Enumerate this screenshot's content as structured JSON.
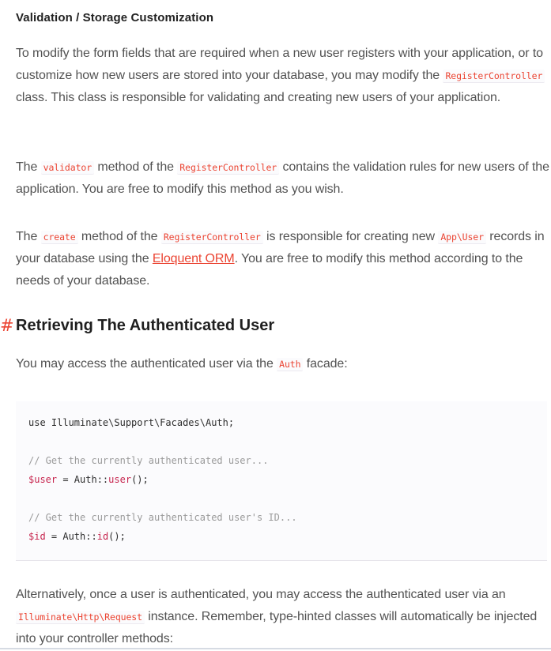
{
  "section_title": "Validation / Storage Customization",
  "paragraph1": {
    "before": "To modify the form fields that are required when a new user registers with your application, or to customize how new users are stored into your database, you may modify the ",
    "code": "RegisterController",
    "after": " class. This class is responsible for validating and creating new users of your application."
  },
  "paragraph2": {
    "t1": "The ",
    "code1": "validator",
    "t2": " method of the ",
    "code2": "RegisterController",
    "t3": " contains the validation rules for new users of the application. You are free to modify this method as you wish."
  },
  "paragraph3": {
    "t1": "The ",
    "code1": "create",
    "t2": " method of the ",
    "code2": "RegisterController",
    "t3": " is responsible for creating new ",
    "code3": "App\\User",
    "t4": " records in your database using the ",
    "link": "Eloquent ORM",
    "t5": ". You are free to modify this method according to the needs of your database."
  },
  "heading": {
    "hash": "#",
    "title": "Retrieving The Authenticated User"
  },
  "paragraph4": {
    "t1": "You may access the authenticated user via the ",
    "code": "Auth",
    "t2": " facade:"
  },
  "code_block": {
    "line1": "use Illuminate\\Support\\Facades\\Auth;",
    "comment1": "// Get the currently authenticated user...",
    "line3_var": "$user",
    "line3_mid": " = Auth::",
    "line3_fn": "user",
    "line3_end": "();",
    "comment2": "// Get the currently authenticated user's ID...",
    "line5_var": "$id",
    "line5_mid": " = Auth::",
    "line5_fn": "id",
    "line5_end": "();"
  },
  "paragraph5": {
    "t1": "Alternatively, once a user is authenticated, you may access the authenticated user via an ",
    "code": "Illuminate\\Http\\Request",
    "t2": " instance. Remember, type-hinted classes will automatically be injected into your controller methods:"
  },
  "colors": {
    "accent": "#eb4432",
    "text": "#525252",
    "heading": "#222222",
    "code_bg": "#fbfbfd"
  }
}
